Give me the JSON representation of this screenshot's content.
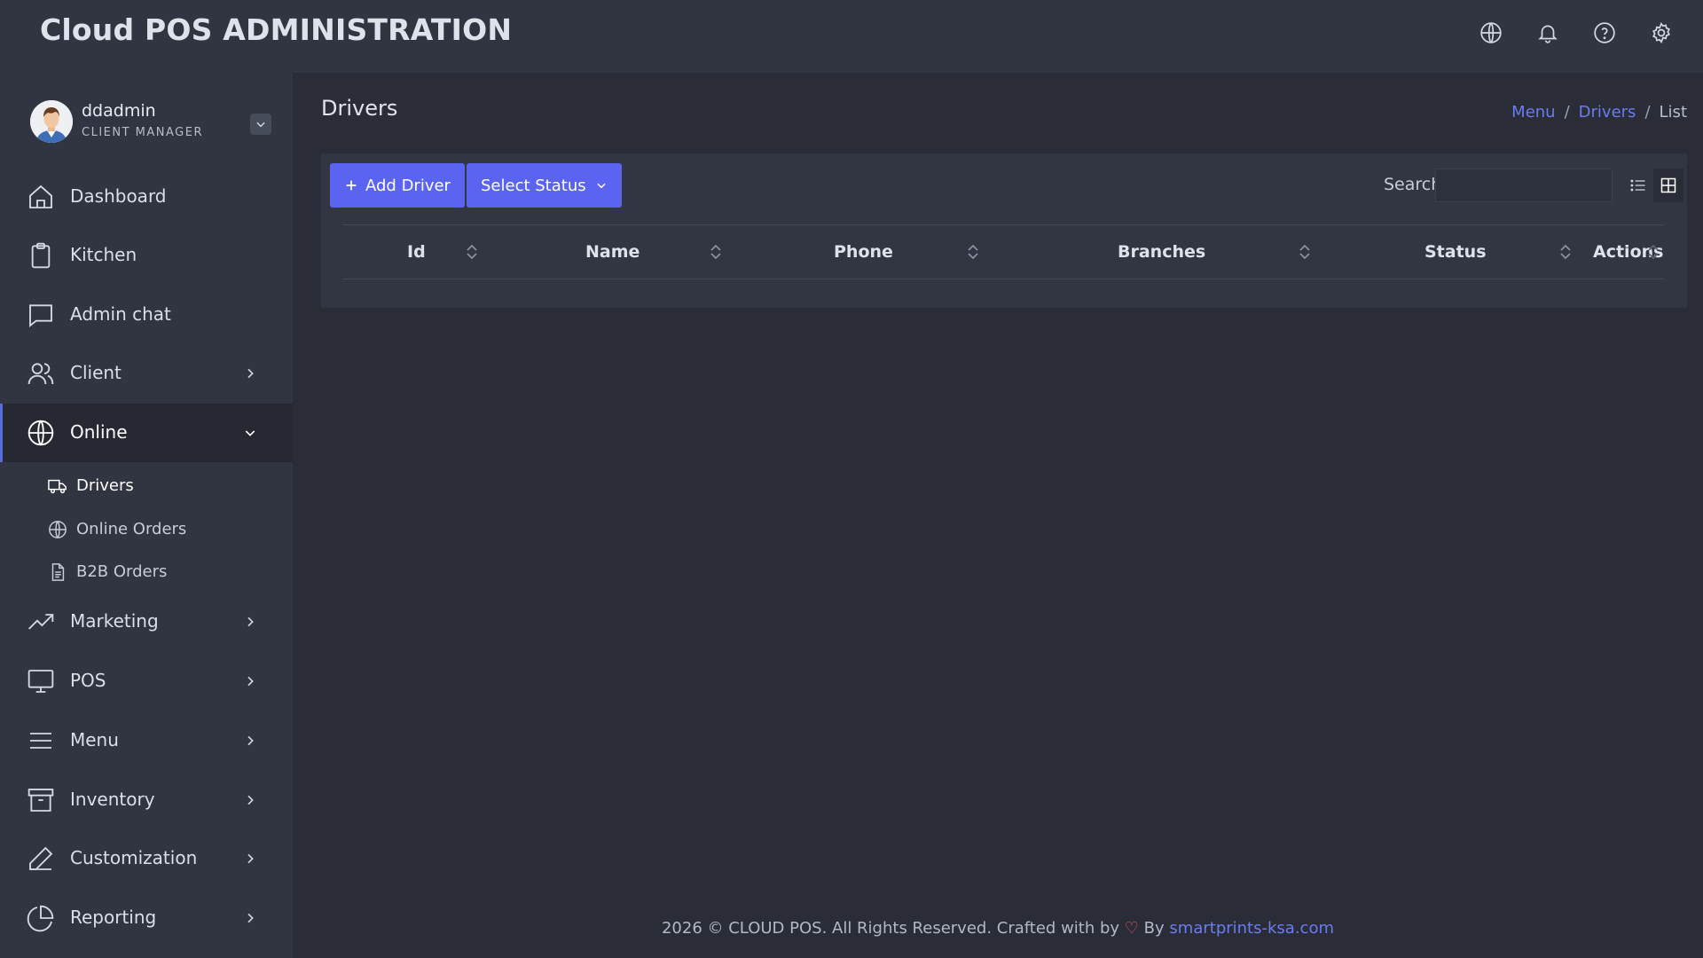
{
  "app": {
    "title": "Cloud POS ADMINISTRATION"
  },
  "topbar": {
    "icons": [
      "globe-icon",
      "bell-icon",
      "help-icon",
      "settings-icon"
    ]
  },
  "user": {
    "name": "ddadmin",
    "role": "CLIENT MANAGER"
  },
  "sidebar": {
    "items": [
      {
        "label": "Dashboard",
        "icon": "home-icon"
      },
      {
        "label": "Kitchen",
        "icon": "clipboard-icon"
      },
      {
        "label": "Admin chat",
        "icon": "chat-icon"
      },
      {
        "label": "Client",
        "icon": "users-icon"
      },
      {
        "label": "Online",
        "icon": "globe-icon"
      },
      {
        "label": "Marketing",
        "icon": "trending-up-icon"
      },
      {
        "label": "POS",
        "icon": "monitor-icon"
      },
      {
        "label": "Menu",
        "icon": "menu-icon"
      },
      {
        "label": "Inventory",
        "icon": "archive-icon"
      },
      {
        "label": "Customization",
        "icon": "pen-icon"
      },
      {
        "label": "Reporting",
        "icon": "pie-chart-icon"
      }
    ],
    "online_subitems": [
      {
        "label": "Drivers",
        "icon": "truck-icon"
      },
      {
        "label": "Online Orders",
        "icon": "globe-icon"
      },
      {
        "label": "B2B Orders",
        "icon": "file-icon"
      }
    ]
  },
  "page": {
    "title": "Drivers"
  },
  "breadcrumb": {
    "items": [
      "Menu",
      "Drivers",
      "List"
    ],
    "separator": "/"
  },
  "toolbar": {
    "add_label": "Add Driver",
    "status_label": "Select Status",
    "search_label": "Search",
    "search_value": ""
  },
  "table": {
    "columns": [
      "Id",
      "Name",
      "Phone",
      "Branches",
      "Status",
      "Actions"
    ],
    "rows": []
  },
  "footer": {
    "text": "2026 © CLOUD POS. All Rights Reserved. Crafted with by",
    "by": "By",
    "link": "smartprints-ksa.com"
  },
  "colors": {
    "accent": "#5a64f0",
    "link": "#6a7cf0",
    "background": "#2a2d38",
    "sidebar": "#313542",
    "heart": "#e45668"
  }
}
